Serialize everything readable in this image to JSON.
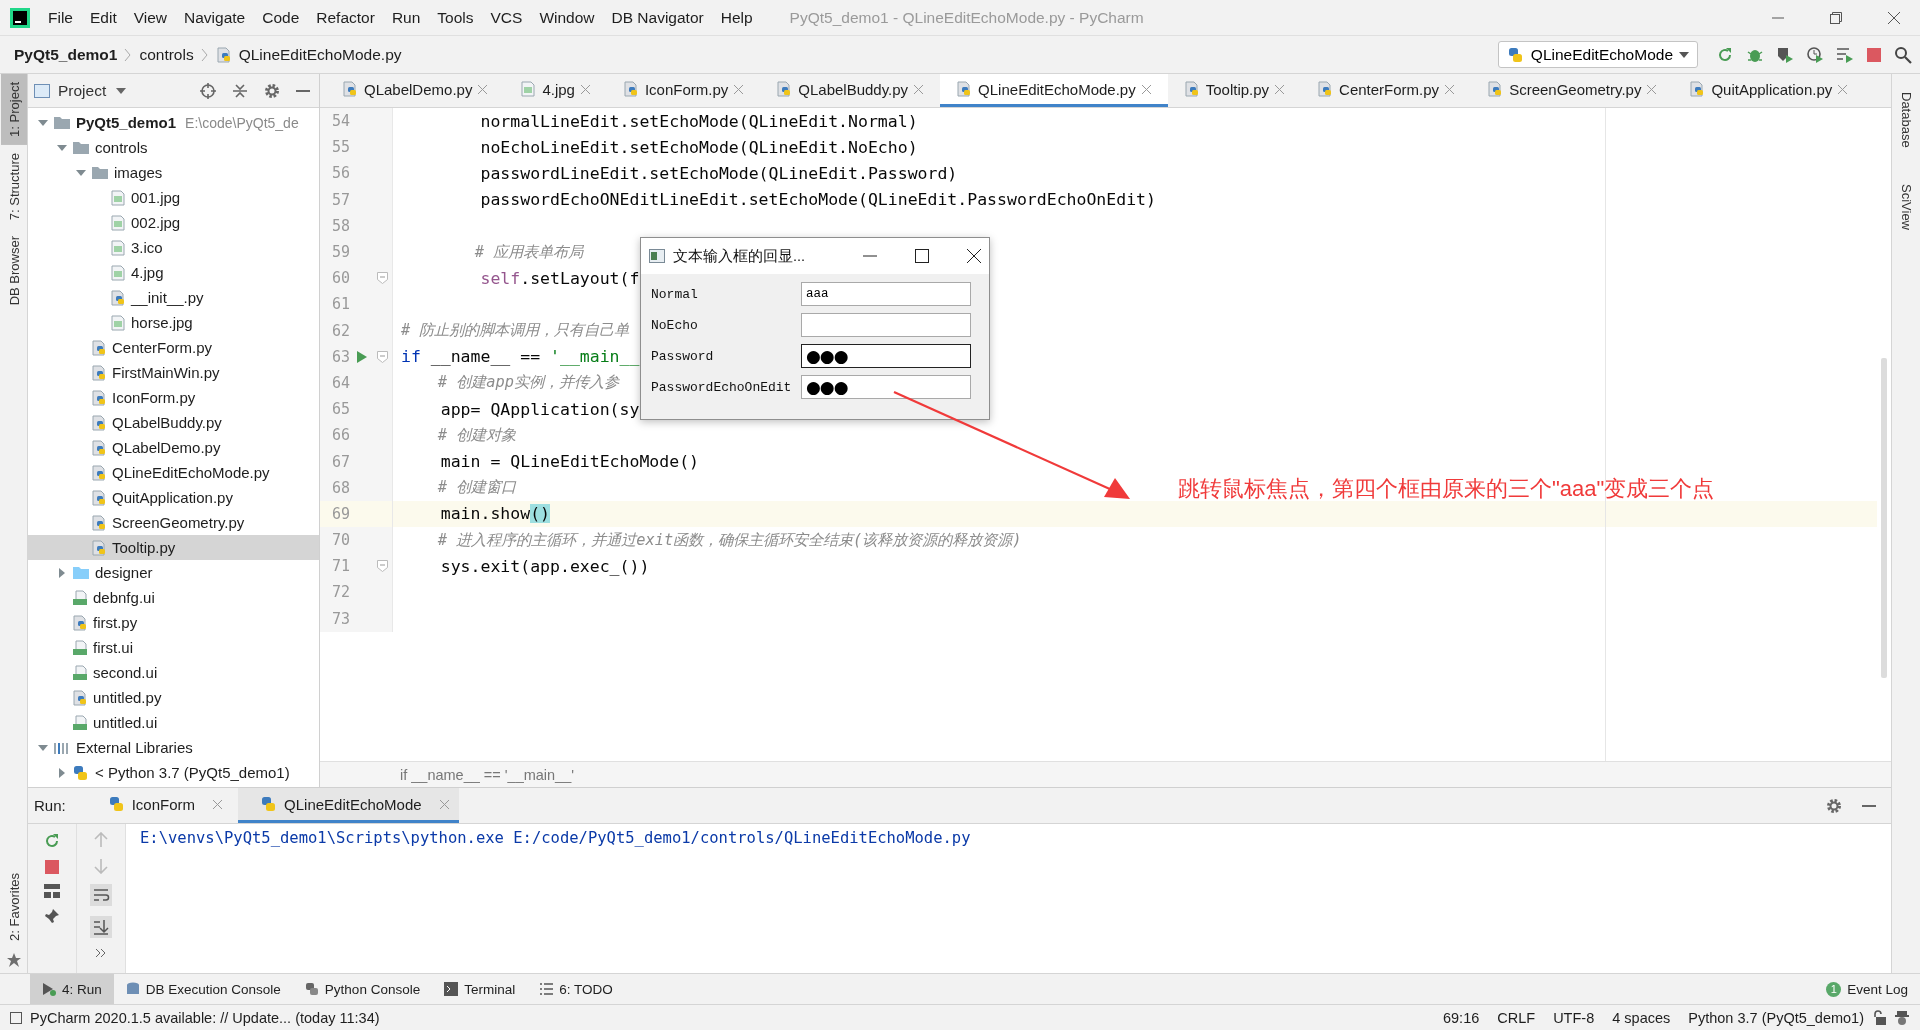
{
  "window": {
    "title": "PyQt5_demo1 - QLineEditEchoMode.py - PyCharm"
  },
  "menu": [
    "File",
    "Edit",
    "View",
    "Navigate",
    "Code",
    "Refactor",
    "Run",
    "Tools",
    "VCS",
    "Window",
    "DB Navigator",
    "Help"
  ],
  "breadcrumb": [
    {
      "label": "PyQt5_demo1",
      "kind": "project"
    },
    {
      "label": "controls",
      "kind": "folder"
    },
    {
      "label": "QLineEditEchoMode.py",
      "kind": "python"
    }
  ],
  "run_config": {
    "label": "QLineEditEchoMode"
  },
  "left_tool_windows": [
    {
      "label": "1: Project",
      "selected": true
    },
    {
      "label": "7: Structure",
      "selected": false
    },
    {
      "label": "DB Browser",
      "selected": false
    }
  ],
  "favorites_tool_window": {
    "label": "2: Favorites"
  },
  "right_tool_windows": [
    "Database",
    "SciView"
  ],
  "project_panel": {
    "title": "Project",
    "tree": [
      {
        "label": "PyQt5_demo1",
        "path": "E:\\code\\PyQt5_de",
        "kind": "folder",
        "expanded": true,
        "selected": false,
        "children": [
          {
            "label": "controls",
            "kind": "folder",
            "expanded": true,
            "selected": false,
            "children": [
              {
                "label": "images",
                "kind": "folder",
                "expanded": true,
                "selected": false,
                "children": [
                  {
                    "label": "001.jpg",
                    "kind": "image",
                    "selected": false
                  },
                  {
                    "label": "002.jpg",
                    "kind": "image",
                    "selected": false
                  },
                  {
                    "label": "3.ico",
                    "kind": "image",
                    "selected": false
                  },
                  {
                    "label": "4.jpg",
                    "kind": "image",
                    "selected": false
                  },
                  {
                    "label": "__init__.py",
                    "kind": "python",
                    "selected": false
                  },
                  {
                    "label": "horse.jpg",
                    "kind": "image",
                    "selected": false
                  }
                ]
              },
              {
                "label": "CenterForm.py",
                "kind": "python",
                "selected": false
              },
              {
                "label": "FirstMainWin.py",
                "kind": "python",
                "selected": false
              },
              {
                "label": "IconForm.py",
                "kind": "python",
                "selected": false
              },
              {
                "label": "QLabelBuddy.py",
                "kind": "python",
                "selected": false
              },
              {
                "label": "QLabelDemo.py",
                "kind": "python",
                "selected": false
              },
              {
                "label": "QLineEditEchoMode.py",
                "kind": "python",
                "selected": false
              },
              {
                "label": "QuitApplication.py",
                "kind": "python",
                "selected": false
              },
              {
                "label": "ScreenGeometry.py",
                "kind": "python",
                "selected": false
              },
              {
                "label": "Tooltip.py",
                "kind": "python",
                "selected": true
              }
            ]
          },
          {
            "label": "designer",
            "kind": "source-folder",
            "expanded": false,
            "selected": false
          },
          {
            "label": "debnfg.ui",
            "kind": "ui",
            "selected": false
          },
          {
            "label": "first.py",
            "kind": "python",
            "selected": false
          },
          {
            "label": "first.ui",
            "kind": "ui",
            "selected": false
          },
          {
            "label": "second.ui",
            "kind": "ui",
            "selected": false
          },
          {
            "label": "untitled.py",
            "kind": "python",
            "selected": false
          },
          {
            "label": "untitled.ui",
            "kind": "ui",
            "selected": false
          }
        ]
      },
      {
        "label": "External Libraries",
        "kind": "library",
        "expanded": true,
        "selected": false,
        "children": [
          {
            "label": "< Python 3.7 (PyQt5_demo1)",
            "kind": "sdk",
            "expanded": false,
            "selected": false
          }
        ]
      }
    ]
  },
  "editor": {
    "tabs": [
      {
        "label": "QLabelDemo.py",
        "kind": "python",
        "selected": false
      },
      {
        "label": "4.jpg",
        "kind": "image",
        "selected": false
      },
      {
        "label": "IconForm.py",
        "kind": "python",
        "selected": false
      },
      {
        "label": "QLabelBuddy.py",
        "kind": "python",
        "selected": false
      },
      {
        "label": "QLineEditEchoMode.py",
        "kind": "python",
        "selected": true
      },
      {
        "label": "Tooltip.py",
        "kind": "python",
        "selected": false
      },
      {
        "label": "CenterForm.py",
        "kind": "python",
        "selected": false
      },
      {
        "label": "ScreenGeometry.py",
        "kind": "python",
        "selected": false
      },
      {
        "label": "QuitApplication.py",
        "kind": "python",
        "selected": false
      }
    ],
    "lines": [
      {
        "number": "54",
        "current": false,
        "run_marker": false,
        "fold": false,
        "segments": [
          {
            "kind": "plain",
            "text": "        normalLineEdit.setEchoMode(QLineEdit.Normal)"
          }
        ]
      },
      {
        "number": "55",
        "current": false,
        "run_marker": false,
        "fold": false,
        "segments": [
          {
            "kind": "plain",
            "text": "        noEchoLineEdit.setEchoMode(QLineEdit.NoEcho)"
          }
        ]
      },
      {
        "number": "56",
        "current": false,
        "run_marker": false,
        "fold": false,
        "segments": [
          {
            "kind": "plain",
            "text": "        passwordLineEdit.setEchoMode(QLineEdit.Password)"
          }
        ]
      },
      {
        "number": "57",
        "current": false,
        "run_marker": false,
        "fold": false,
        "segments": [
          {
            "kind": "plain",
            "text": "        passwordEchoONEditLineEdit.setEchoMode(QLineEdit.PasswordEchoOnEdit)"
          }
        ]
      },
      {
        "number": "58",
        "current": false,
        "run_marker": false,
        "fold": false
      },
      {
        "number": "59",
        "current": false,
        "run_marker": false,
        "fold": false,
        "segments": [
          {
            "kind": "comment",
            "text": "        # 应用表单布局"
          }
        ]
      },
      {
        "number": "60",
        "current": false,
        "run_marker": false,
        "fold": true,
        "segments": [
          {
            "kind": "self",
            "text": "        self"
          },
          {
            "kind": "plain",
            "text": ".setLayout(f"
          }
        ]
      },
      {
        "number": "61",
        "current": false,
        "run_marker": false,
        "fold": false
      },
      {
        "number": "62",
        "current": false,
        "run_marker": false,
        "fold": false,
        "segments": [
          {
            "kind": "comment",
            "text": "# 防止别的脚本调用，只有自己单"
          }
        ]
      },
      {
        "number": "63",
        "current": false,
        "run_marker": true,
        "fold": true,
        "segments": [
          {
            "kind": "keyword",
            "text": "if"
          },
          {
            "kind": "plain",
            "text": " __name__ == "
          },
          {
            "kind": "string",
            "text": "'__main__"
          }
        ]
      },
      {
        "number": "64",
        "current": false,
        "run_marker": false,
        "fold": false,
        "segments": [
          {
            "kind": "comment",
            "text": "    # 创建app实例，并传入参"
          }
        ]
      },
      {
        "number": "65",
        "current": false,
        "run_marker": false,
        "fold": false,
        "segments": [
          {
            "kind": "plain",
            "text": "    app= QApplication(sy"
          }
        ]
      },
      {
        "number": "66",
        "current": false,
        "run_marker": false,
        "fold": false,
        "segments": [
          {
            "kind": "comment",
            "text": "    # 创建对象"
          }
        ]
      },
      {
        "number": "67",
        "current": false,
        "run_marker": false,
        "fold": false,
        "segments": [
          {
            "kind": "plain",
            "text": "    main = QLineEditEchoMode()"
          }
        ]
      },
      {
        "number": "68",
        "current": false,
        "run_marker": false,
        "fold": false,
        "segments": [
          {
            "kind": "comment",
            "text": "    # 创建窗口"
          }
        ]
      },
      {
        "number": "69",
        "current": true,
        "run_marker": false,
        "fold": false,
        "segments": [
          {
            "kind": "plain",
            "text": "    main.show"
          },
          {
            "kind": "matched",
            "text": "()"
          }
        ]
      },
      {
        "number": "70",
        "current": false,
        "run_marker": false,
        "fold": false,
        "segments": [
          {
            "kind": "comment",
            "text": "    # 进入程序的主循环，并通过exit函数，确保主循环安全结束(该释放资源的释放资源)"
          }
        ]
      },
      {
        "number": "71",
        "current": false,
        "run_marker": false,
        "fold": true,
        "segments": [
          {
            "kind": "plain",
            "text": "    sys.exit(app.exec_())"
          }
        ]
      },
      {
        "number": "72",
        "current": false,
        "run_marker": false,
        "fold": false
      },
      {
        "number": "73",
        "current": false,
        "run_marker": false,
        "fold": false
      }
    ],
    "breadcrumb": "if __name__ == '__main__'"
  },
  "dialog": {
    "title": "文本输入框的回显...",
    "rows": [
      {
        "label": "Normal",
        "kind": "plain",
        "value": "aaa",
        "focused": false
      },
      {
        "label": "NoEcho",
        "kind": "plain",
        "focused": false
      },
      {
        "label": "Password",
        "kind": "masked",
        "value": "●●●",
        "focused": true
      },
      {
        "label": "PasswordEchoOnEdit",
        "kind": "masked",
        "value": "●●●",
        "focused": false
      }
    ]
  },
  "annotation": {
    "text": "跳转鼠标焦点，第四个框由原来的三个\"aaa\"变成三个点"
  },
  "run_panel": {
    "label": "Run:",
    "tabs": [
      {
        "label": "IconForm",
        "selected": false
      },
      {
        "label": "QLineEditEchoMode",
        "selected": true
      }
    ],
    "output": [
      "E:\\venvs\\PyQt5_demo1\\Scripts\\python.exe E:/code/PyQt5_demo1/controls/QLineEditEchoMode.py"
    ]
  },
  "tool_tabs": [
    {
      "label": "4: Run",
      "kind": "run",
      "selected": true
    },
    {
      "label": "DB Execution Console",
      "kind": "db",
      "selected": false
    },
    {
      "label": "Python Console",
      "kind": "python",
      "selected": false
    },
    {
      "label": "Terminal",
      "kind": "terminal",
      "selected": false
    },
    {
      "label": "6: TODO",
      "kind": "todo",
      "selected": false
    }
  ],
  "event_log": {
    "label": "Event Log",
    "badge": "1"
  },
  "status_bar": {
    "message": "PyCharm 2020.1.5 available: // Update... (today 11:34)",
    "items": [
      "69:16",
      "CRLF",
      "UTF-8",
      "4 spaces",
      "Python 3.7 (PyQt5_demo1)"
    ]
  }
}
